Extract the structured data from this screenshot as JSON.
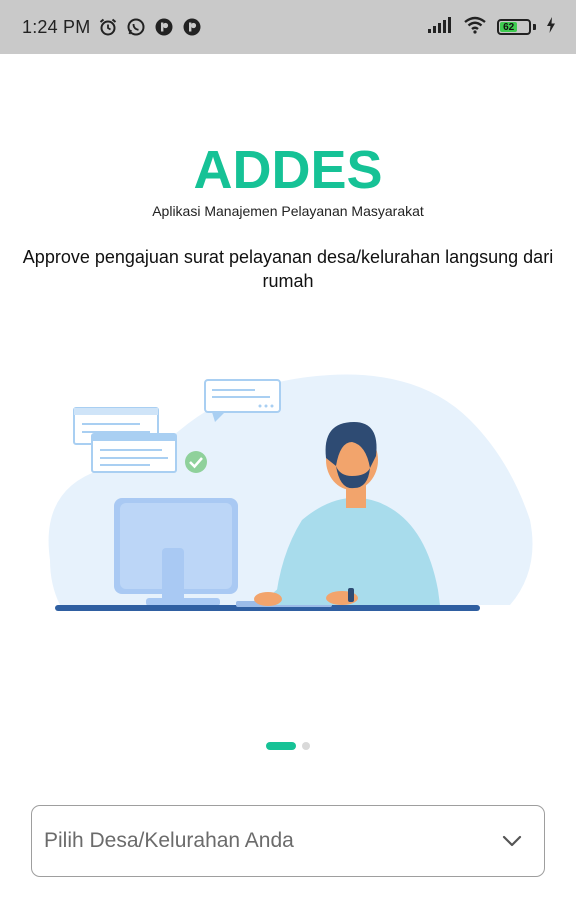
{
  "status_bar": {
    "time": "1:24 PM",
    "icons": [
      "alarm-icon",
      "whatsapp-icon",
      "app-notification-icon",
      "app-notification-icon"
    ],
    "battery_level": "62"
  },
  "header": {
    "title": "ADDES",
    "subtitle": "Aplikasi Manajemen Pelayanan Masyarakat",
    "title_color": "#16c296"
  },
  "onboarding": {
    "tagline": "Approve pengajuan surat pelayanan desa/kelurahan langsung dari rumah",
    "page_index": 1,
    "page_count": 2
  },
  "village_select": {
    "placeholder": "Pilih Desa/Kelurahan Anda"
  }
}
